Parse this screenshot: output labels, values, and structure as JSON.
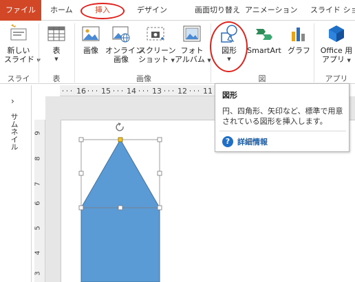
{
  "tabs": {
    "file": "ファイル",
    "home": "ホーム",
    "insert": "挿入",
    "design": "デザイン",
    "transitions": "画面切り替え",
    "animations": "アニメーション",
    "slideshow": "スライド ショー"
  },
  "ribbon": {
    "new_slide": [
      "新しい",
      "スライド"
    ],
    "table": "表",
    "image": "画像",
    "online_image": [
      "オンライン",
      "画像"
    ],
    "screenshot": [
      "スクリーン",
      "ショット"
    ],
    "photo_album": [
      "フォト",
      "アルバム"
    ],
    "shapes": "図形",
    "smartart": "SmartArt",
    "graph": "グラフ",
    "office_apps": [
      "Office 用",
      "アプリ"
    ],
    "group_slide": "スライド",
    "group_table": "表",
    "group_images": "画像",
    "group_illust": "図",
    "group_apps": "アプリ"
  },
  "ruler": {
    "h_ticks": [
      "16",
      "15",
      "14",
      "13",
      "12",
      "11"
    ],
    "v_ticks": [
      "9",
      "8",
      "7",
      "6",
      "5",
      "4",
      "3"
    ]
  },
  "thumbnail_pane": {
    "label": "サムネイル"
  },
  "tooltip": {
    "title": "図形",
    "description": "円、四角形、矢印など、標準で用意されている図形を挿入します。",
    "help_link": "詳細情報"
  },
  "colors": {
    "accent": "#d24726",
    "annotation": "#e0201a",
    "shape_fill": "#5b9bd5",
    "shape_stroke": "#41719c"
  }
}
